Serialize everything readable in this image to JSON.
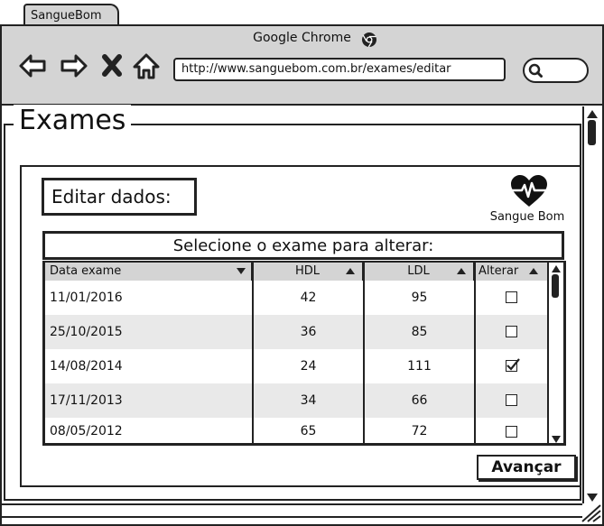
{
  "browser": {
    "tab_label": "SangueBom",
    "window_title": "Google Chrome",
    "url": "http://www.sanguebom.com.br/exames/editar",
    "icons": [
      "back-arrow-icon",
      "forward-arrow-icon",
      "stop-icon",
      "home-icon",
      "search-icon",
      "chrome-logo-icon"
    ]
  },
  "page": {
    "section_title": "Exames",
    "edit_label": "Editar dados:",
    "logo_text": "Sangue Bom",
    "select_prompt": "Selecione o exame para alterar:",
    "next_button": "Avançar"
  },
  "table": {
    "columns": [
      "Data exame",
      "HDL",
      "LDL",
      "Alterar"
    ],
    "rows": [
      {
        "date": "11/01/2016",
        "hdl": "42",
        "ldl": "95",
        "alter": false
      },
      {
        "date": "25/10/2015",
        "hdl": "36",
        "ldl": "85",
        "alter": false
      },
      {
        "date": "14/08/2014",
        "hdl": "24",
        "ldl": "111",
        "alter": true
      },
      {
        "date": "17/11/2013",
        "hdl": "34",
        "ldl": "66",
        "alter": false
      },
      {
        "date": "08/05/2012",
        "hdl": "65",
        "ldl": "72",
        "alter": false
      }
    ]
  },
  "colors": {
    "chrome_gray": "#d4d4d4",
    "row_alt": "#e9e9e9",
    "ink": "#222222"
  }
}
